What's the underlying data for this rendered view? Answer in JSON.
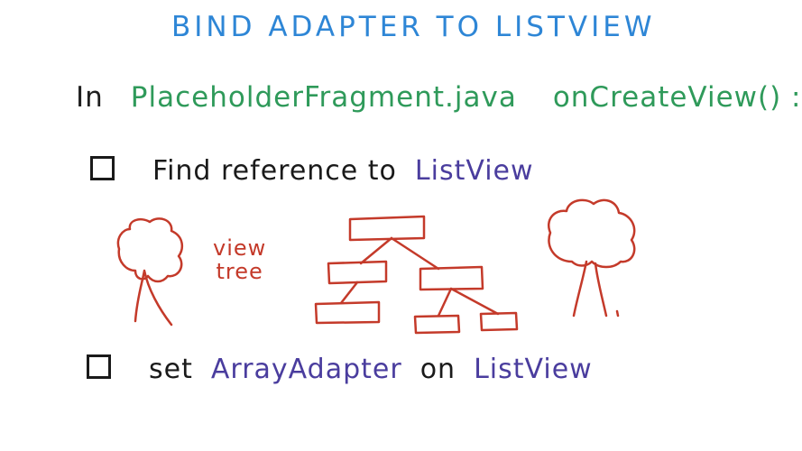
{
  "title": "BIND ADAPTER TO LISTVIEW",
  "intro": {
    "prefix": "In",
    "file": "PlaceholderFragment.java",
    "method": "onCreateView() :"
  },
  "tasks": [
    {
      "text": "Find reference to",
      "highlight": "ListView"
    },
    {
      "text": "set",
      "highlight": "ArrayAdapter",
      "middle": "on",
      "highlight2": "ListView"
    }
  ],
  "diagram": {
    "label_line1": "view",
    "label_line2": "tree"
  },
  "colors": {
    "title": "#2e86d6",
    "code": "#2f9a5a",
    "highlight": "#4a3d9e",
    "text": "#1a1a1a",
    "sketch": "#c43a2a"
  }
}
